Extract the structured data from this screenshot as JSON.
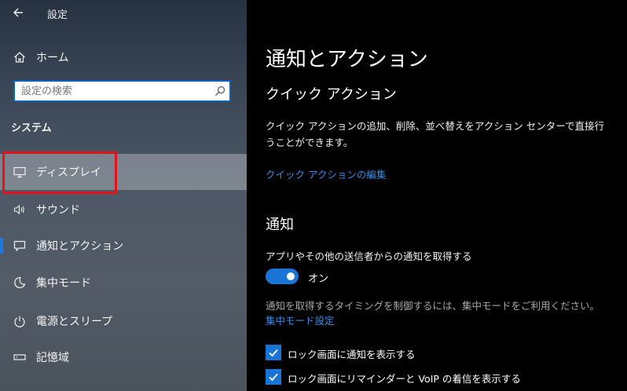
{
  "window": {
    "title": "設定"
  },
  "sidebar": {
    "home_label": "ホーム",
    "search": {
      "placeholder": "設定の検索"
    },
    "section_label": "システム",
    "items": [
      {
        "label": "ディスプレイ",
        "icon": "monitor-icon"
      },
      {
        "label": "サウンド",
        "icon": "speaker-icon"
      },
      {
        "label": "通知とアクション",
        "icon": "message-icon"
      },
      {
        "label": "集中モード",
        "icon": "moon-icon"
      },
      {
        "label": "電源とスリープ",
        "icon": "power-icon"
      },
      {
        "label": "記憶域",
        "icon": "storage-icon"
      }
    ]
  },
  "main": {
    "title": "通知とアクション",
    "quick_actions": {
      "heading": "クイック アクション",
      "description": "クイック アクションの追加、削除、並べ替えをアクション センターで直接行うことができます。",
      "edit_link": "クイック アクションの編集"
    },
    "notifications": {
      "heading": "通知",
      "get_notifications_label": "アプリやその他の送信者からの通知を取得する",
      "toggle_state": "オン",
      "focus_hint": "通知を取得するタイミングを制御するには、集中モードをご利用ください。",
      "focus_link": "集中モード設定",
      "checkboxes": [
        {
          "label": "ロック画面に通知を表示する",
          "checked": true
        },
        {
          "label": "ロック画面にリマインダーと VoIP の着信を表示する",
          "checked": true
        }
      ]
    }
  },
  "colors": {
    "accent": "#1a74d6",
    "link": "#3a8ee6",
    "highlight_box": "#e0141a"
  }
}
